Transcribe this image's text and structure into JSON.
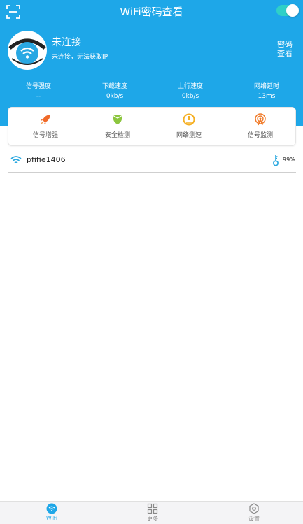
{
  "app": {
    "title": "WiFi密码查看"
  },
  "connection": {
    "status": "未连接",
    "detail": "未连接，无法获取IP",
    "password_button": "密码查看"
  },
  "stats": [
    {
      "label": "信号强度",
      "value": "--"
    },
    {
      "label": "下载速度",
      "value": "0kb/s"
    },
    {
      "label": "上行速度",
      "value": "0kb/s"
    },
    {
      "label": "网络延时",
      "value": "13ms"
    }
  ],
  "tools": [
    {
      "label": "信号增强",
      "icon": "rocket-icon",
      "color": "#f06a2a"
    },
    {
      "label": "安全检测",
      "icon": "shield-icon",
      "color": "#8cc63f"
    },
    {
      "label": "网络测速",
      "icon": "speedometer-icon",
      "color": "#f5b025"
    },
    {
      "label": "信号监测",
      "icon": "signal-tower-icon",
      "color": "#f07b2a"
    }
  ],
  "networks": [
    {
      "ssid": "pfifie1406",
      "strength": "99%"
    }
  ],
  "bottom_nav": [
    {
      "label": "WiFi",
      "icon": "wifi-icon",
      "active": true
    },
    {
      "label": "更多",
      "icon": "grid-icon",
      "active": false
    },
    {
      "label": "设置",
      "icon": "settings-icon",
      "active": false
    }
  ],
  "colors": {
    "primary": "#1ea7e8",
    "toggle": "#2fd0c7",
    "text_dark": "#222222"
  }
}
